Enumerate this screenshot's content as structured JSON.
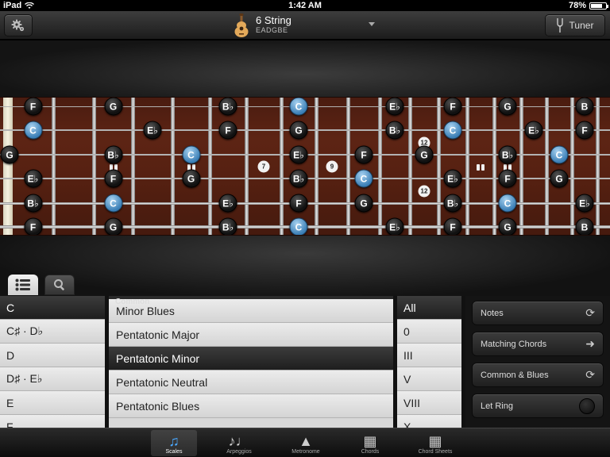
{
  "status": {
    "device": "iPad",
    "time": "1:42 AM",
    "battery": "78%",
    "battery_level": 0.78
  },
  "toolbar": {
    "instrument": "6 String",
    "tuning": "EADGBE",
    "tuner": "Tuner"
  },
  "fretboard": {
    "frets": 13,
    "strings": 6,
    "inlays": [
      {
        "label": "7",
        "fret": 7,
        "between_strings": [
          3,
          4
        ]
      },
      {
        "label": "9",
        "fret": 9,
        "between_strings": [
          3,
          4
        ]
      },
      {
        "label": "12",
        "fret": 12,
        "between_strings": [
          2,
          3
        ]
      },
      {
        "label": "12",
        "fret": 12,
        "between_strings": [
          4,
          5
        ]
      }
    ],
    "bend_markers": [
      {
        "fret": 3,
        "string": 4
      },
      {
        "fret": 5,
        "string": 4
      },
      {
        "fret": 14,
        "string": 4
      },
      {
        "fret": 15,
        "string": 4
      }
    ],
    "notes": [
      {
        "label": "F",
        "string": 1,
        "fret": 1,
        "root": false
      },
      {
        "label": "G",
        "string": 1,
        "fret": 3,
        "root": false
      },
      {
        "label": "B♭",
        "string": 1,
        "fret": 6,
        "root": false
      },
      {
        "label": "C",
        "string": 1,
        "fret": 8,
        "root": true
      },
      {
        "label": "E♭",
        "string": 1,
        "fret": 11,
        "root": false
      },
      {
        "label": "F",
        "string": 1,
        "fret": 13,
        "root": false
      },
      {
        "label": "G",
        "string": 1,
        "fret": 15,
        "root": false
      },
      {
        "label": "B",
        "string": 1,
        "fret": 18,
        "root": false
      },
      {
        "label": "C",
        "string": 2,
        "fret": 1,
        "root": true
      },
      {
        "label": "E♭",
        "string": 2,
        "fret": 4,
        "root": false
      },
      {
        "label": "F",
        "string": 2,
        "fret": 6,
        "root": false
      },
      {
        "label": "G",
        "string": 2,
        "fret": 8,
        "root": false
      },
      {
        "label": "B♭",
        "string": 2,
        "fret": 11,
        "root": false
      },
      {
        "label": "C",
        "string": 2,
        "fret": 13,
        "root": true
      },
      {
        "label": "E♭",
        "string": 2,
        "fret": 16,
        "root": false
      },
      {
        "label": "F",
        "string": 2,
        "fret": 18,
        "root": false
      },
      {
        "label": "G",
        "string": 3,
        "fret": 0,
        "root": false
      },
      {
        "label": "B♭",
        "string": 3,
        "fret": 3,
        "root": false
      },
      {
        "label": "C",
        "string": 3,
        "fret": 5,
        "root": true
      },
      {
        "label": "E♭",
        "string": 3,
        "fret": 8,
        "root": false
      },
      {
        "label": "F",
        "string": 3,
        "fret": 10,
        "root": false
      },
      {
        "label": "G",
        "string": 3,
        "fret": 12,
        "root": false
      },
      {
        "label": "B♭",
        "string": 3,
        "fret": 15,
        "root": false
      },
      {
        "label": "C",
        "string": 3,
        "fret": 17,
        "root": true
      },
      {
        "label": "E♭",
        "string": 4,
        "fret": 1,
        "root": false
      },
      {
        "label": "F",
        "string": 4,
        "fret": 3,
        "root": false
      },
      {
        "label": "G",
        "string": 4,
        "fret": 5,
        "root": false
      },
      {
        "label": "B♭",
        "string": 4,
        "fret": 8,
        "root": false
      },
      {
        "label": "C",
        "string": 4,
        "fret": 10,
        "root": true
      },
      {
        "label": "E♭",
        "string": 4,
        "fret": 13,
        "root": false
      },
      {
        "label": "F",
        "string": 4,
        "fret": 15,
        "root": false
      },
      {
        "label": "G",
        "string": 4,
        "fret": 17,
        "root": false
      },
      {
        "label": "B♭",
        "string": 5,
        "fret": 1,
        "root": false
      },
      {
        "label": "C",
        "string": 5,
        "fret": 3,
        "root": true
      },
      {
        "label": "E♭",
        "string": 5,
        "fret": 6,
        "root": false
      },
      {
        "label": "F",
        "string": 5,
        "fret": 8,
        "root": false
      },
      {
        "label": "G",
        "string": 5,
        "fret": 10,
        "root": false
      },
      {
        "label": "B♭",
        "string": 5,
        "fret": 13,
        "root": false
      },
      {
        "label": "C",
        "string": 5,
        "fret": 15,
        "root": true
      },
      {
        "label": "E♭",
        "string": 5,
        "fret": 18,
        "root": false
      },
      {
        "label": "F",
        "string": 6,
        "fret": 1,
        "root": false
      },
      {
        "label": "G",
        "string": 6,
        "fret": 3,
        "root": false
      },
      {
        "label": "B♭",
        "string": 6,
        "fret": 6,
        "root": false
      },
      {
        "label": "C",
        "string": 6,
        "fret": 8,
        "root": true
      },
      {
        "label": "E♭",
        "string": 6,
        "fret": 11,
        "root": false
      },
      {
        "label": "F",
        "string": 6,
        "fret": 13,
        "root": false
      },
      {
        "label": "G",
        "string": 6,
        "fret": 15,
        "root": false
      },
      {
        "label": "B",
        "string": 6,
        "fret": 18,
        "root": false
      }
    ]
  },
  "roots": {
    "items": [
      "C",
      "C♯ · D♭",
      "D",
      "D♯ · E♭",
      "E",
      "F"
    ],
    "selected": 0
  },
  "scales": {
    "group_header": "Common",
    "items": [
      "Minor Blues",
      "Pentatonic Major",
      "Pentatonic Minor",
      "Pentatonic Neutral",
      "Pentatonic Blues"
    ],
    "selected": 2
  },
  "positions": {
    "items": [
      "All",
      "0",
      "III",
      "V",
      "VIII",
      "X"
    ],
    "selected": 0
  },
  "options": {
    "notes": "Notes",
    "matching_chords": "Matching Chords",
    "common_blues": "Common & Blues",
    "let_ring": "Let Ring"
  },
  "tabs": [
    {
      "label": "Scales",
      "icon": "music-note-icon",
      "active": true
    },
    {
      "label": "Arpeggios",
      "icon": "arpeggio-notes-icon",
      "active": false
    },
    {
      "label": "Metronome",
      "icon": "metronome-icon",
      "active": false
    },
    {
      "label": "Chords",
      "icon": "chord-grid-icon",
      "active": false
    },
    {
      "label": "Chord Sheets",
      "icon": "chord-sheet-icon",
      "active": false
    }
  ]
}
